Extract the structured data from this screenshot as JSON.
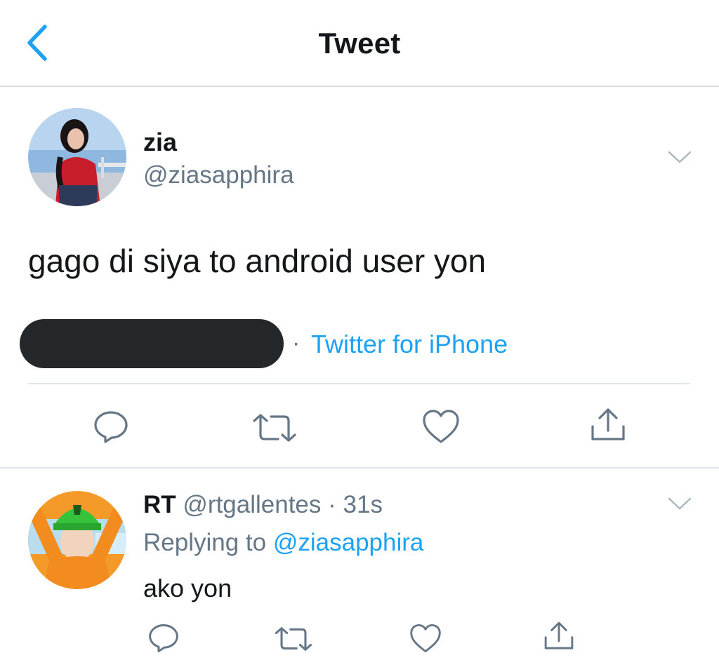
{
  "nav": {
    "title": "Tweet",
    "back_icon": "chevron-left-icon"
  },
  "tweet": {
    "author_name": "zia",
    "author_handle": "@ziasapphira",
    "text": "gago di siya to android user yon",
    "separator": "·",
    "source": "Twitter for iPhone",
    "actions": [
      "reply-icon",
      "retweet-icon",
      "like-icon",
      "share-icon"
    ]
  },
  "reply": {
    "author_name": "RT",
    "author_handle": "@rtgallentes",
    "time": "· 31s",
    "replying_prefix": "Replying to",
    "replying_to": "@ziasapphira",
    "text": "ako yon",
    "actions": [
      "reply-icon",
      "retweet-icon",
      "like-icon",
      "share-icon"
    ]
  },
  "colors": {
    "accent": "#1da1f2",
    "secondary_text": "#657786",
    "primary_text": "#14171a",
    "divider": "#e1e6ea",
    "redaction": "#25282b"
  }
}
